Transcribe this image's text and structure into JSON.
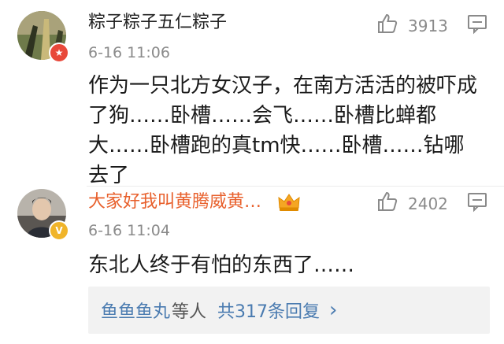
{
  "comments": [
    {
      "username": "粽子粽子五仁粽子",
      "time": "6-16 11:06",
      "likes": "3913",
      "text_lines": [
        "作为一只北方女汉子，在南方活活的被吓成",
        "了狗……卧槽……会飞……卧槽比蝉都",
        "大……卧槽跑的真tm快……卧槽……钻哪",
        "去了"
      ],
      "username_color": "#222222",
      "badge_color": "#e8483a",
      "badge_icon": "star-badge-icon"
    },
    {
      "username": "大家好我叫黄腾威黄…",
      "time": "6-16 11:04",
      "likes": "2402",
      "text_lines": [
        "东北人终于有怕的东西了……"
      ],
      "username_color": "#e8602c",
      "badge_color": "#f0b429",
      "badge_icon": "verified-v-icon",
      "crown_icon": "vip-crown-icon"
    }
  ],
  "replies": {
    "names": "鱼鱼鱼丸",
    "suffix": "等人",
    "count": "共317条回复",
    "arrow": "›"
  }
}
